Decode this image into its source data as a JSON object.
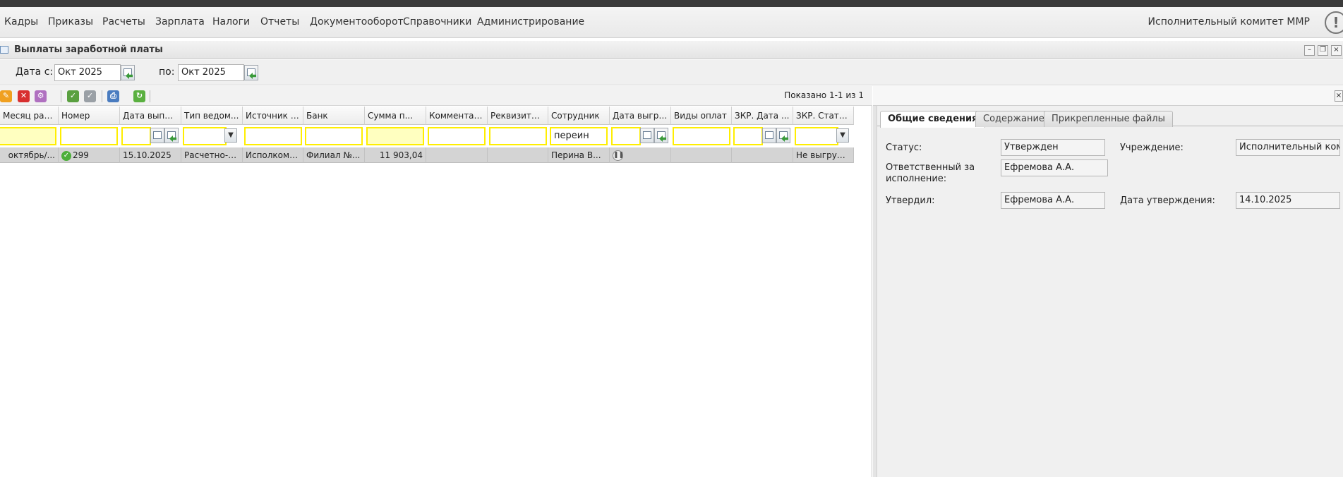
{
  "menu": {
    "items": [
      "Кадры",
      "Приказы",
      "Расчеты",
      "Зарплата",
      "Налоги",
      "Отчеты",
      "Документооборот",
      "Справочники",
      "Администрирование"
    ],
    "org": "Исполнительный комитет ММР"
  },
  "panel": {
    "title": "Выплаты заработной платы"
  },
  "datebar": {
    "from_label": "Дата с:",
    "from_value": "Окт 2025",
    "to_label": "по:",
    "to_value": "Окт 2025"
  },
  "toolbar": {
    "shown": "Показано 1-1 из 1"
  },
  "grid": {
    "columns": [
      "Месяц расч...",
      "Номер",
      "Дата выпл...",
      "Тип ведом...",
      "Источник в...",
      "Банк",
      "Сумма п...",
      "Комментар...",
      "Реквизиты ...",
      "Сотрудник",
      "Дата выгру...",
      "Виды оплат",
      "ЗКР. Дата ...",
      "ЗКР. Стату..."
    ],
    "filter_employee": "переин",
    "row": {
      "month": "октябрь/...",
      "number": "299",
      "date": "15.10.2025",
      "type": "Расчетно-п...",
      "source": "Исполком з...",
      "bank": "Филиал №...",
      "sum": "11 903,04",
      "comment": "",
      "requisites": "",
      "employee": "Перина В...",
      "upload_date": "",
      "pay_types": "",
      "zkr_date": "",
      "zkr_status": "Не выгруж..."
    }
  },
  "details": {
    "tabs": [
      "Общие сведения",
      "Содержание",
      "Прикрепленные файлы"
    ],
    "status_label": "Статус:",
    "status_value": "Утвержден",
    "org_label": "Учреждение:",
    "org_value": "Исполнительный коми",
    "responsible_label_1": "Ответственный за",
    "responsible_label_2": "исполнение:",
    "responsible_value": "Ефремова А.А.",
    "approved_by_label": "Утвердил:",
    "approved_by_value": "Ефремова А.А.",
    "approved_date_label": "Дата утверждения:",
    "approved_date_value": "14.10.2025"
  }
}
